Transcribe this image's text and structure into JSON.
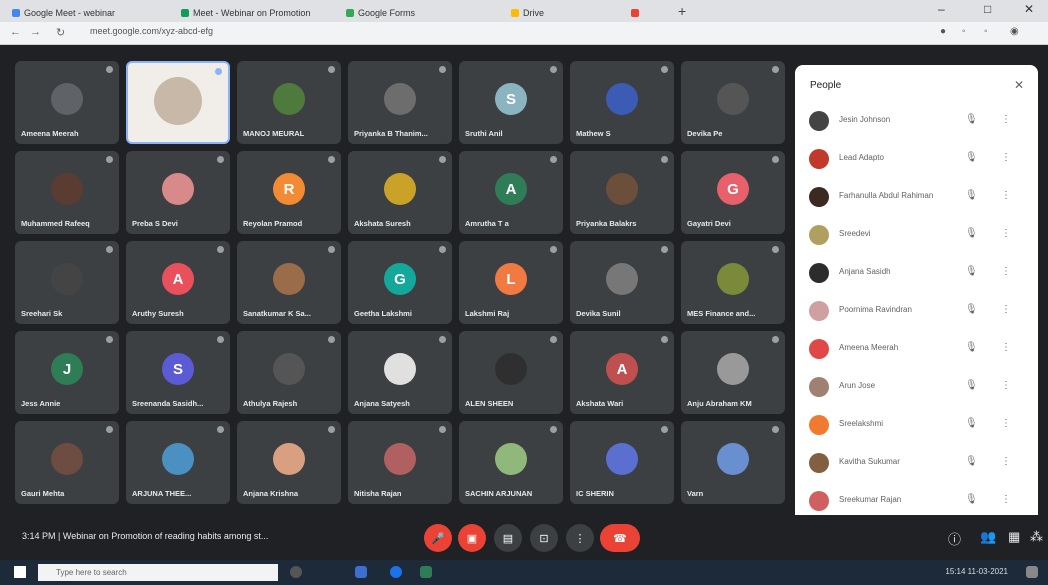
{
  "browser": {
    "tabs": [
      {
        "label": "Google Meet - webinar",
        "color": "#4285f4"
      },
      {
        "label": "Meet - Webinar on Promotion",
        "color": "#0f9d58"
      },
      {
        "label": "Google Forms",
        "color": "#34a853"
      },
      {
        "label": "Drive",
        "color": "#fbbc04"
      },
      {
        "label": "",
        "color": "#ea4335"
      }
    ],
    "new_tab": "+",
    "url": "meet.google.com/xyz-abcd-efg",
    "window_controls": {
      "minimize": "–",
      "maximize": "□",
      "close": "✕"
    }
  },
  "participants": [
    {
      "name": "Ameena Meerah",
      "color": "#5f6368",
      "initial": ""
    },
    {
      "name": "",
      "color": "#e8e2d8",
      "initial": ""
    },
    {
      "name": "MANOJ MEURAL",
      "color": "#4e7a3e",
      "initial": ""
    },
    {
      "name": "Priyanka B Thanim...",
      "color": "#6d6d6d",
      "initial": ""
    },
    {
      "name": "Sruthi Anil",
      "color": "#8ab4c0",
      "initial": "S"
    },
    {
      "name": "Mathew S",
      "color": "#3b5bb5",
      "initial": ""
    },
    {
      "name": "Devika Pe",
      "color": "#555",
      "initial": ""
    },
    {
      "name": "Muhammed Rafeeq",
      "color": "#5a3c32",
      "initial": ""
    },
    {
      "name": "Preba S Devi",
      "color": "#d88a8a",
      "initial": ""
    },
    {
      "name": "Reyolan Pramod",
      "color": "#f28b31",
      "initial": "R"
    },
    {
      "name": "Akshata Suresh",
      "color": "#c9a227",
      "initial": ""
    },
    {
      "name": "Amrutha T a",
      "color": "#2e7d57",
      "initial": "A"
    },
    {
      "name": "Priyanka Balakrs",
      "color": "#6b4f3a",
      "initial": ""
    },
    {
      "name": "Gayatri Devi",
      "color": "#e8606a",
      "initial": "G"
    },
    {
      "name": "Sreehari Sk",
      "color": "#444",
      "initial": ""
    },
    {
      "name": "Aruthy Suresh",
      "color": "#e8505b",
      "initial": "A"
    },
    {
      "name": "Sanatkumar K Sa...",
      "color": "#9a6c4a",
      "initial": ""
    },
    {
      "name": "Geetha Lakshmi",
      "color": "#14a89b",
      "initial": "G"
    },
    {
      "name": "Lakshmi Raj",
      "color": "#f07a42",
      "initial": "L"
    },
    {
      "name": "Devika Sunil",
      "color": "#777",
      "initial": ""
    },
    {
      "name": "MES Finance and...",
      "color": "#7a8a3a",
      "initial": ""
    },
    {
      "name": "Jess Annie",
      "color": "#2e7d57",
      "initial": "J"
    },
    {
      "name": "Sreenanda Sasidh...",
      "color": "#5b5bd6",
      "initial": "S"
    },
    {
      "name": "Athulya Rajesh",
      "color": "#555",
      "initial": ""
    },
    {
      "name": "Anjana Satyesh",
      "color": "#e0e0e0",
      "initial": ""
    },
    {
      "name": "ALEN SHEEN",
      "color": "#2f2f2f",
      "initial": ""
    },
    {
      "name": "Akshata Wari",
      "color": "#c05050",
      "initial": "A"
    },
    {
      "name": "Anju Abraham KM",
      "color": "#999",
      "initial": ""
    },
    {
      "name": "Gauri Mehta",
      "color": "#6d4c41",
      "initial": ""
    },
    {
      "name": "ARJUNA THEE...",
      "color": "#4a90c0",
      "initial": ""
    },
    {
      "name": "Anjana Krishna",
      "color": "#d8a080",
      "initial": ""
    },
    {
      "name": "Nitisha Rajan",
      "color": "#b06060",
      "initial": ""
    },
    {
      "name": "SACHIN ARJUNAN",
      "color": "#8fb87a",
      "initial": ""
    },
    {
      "name": "IC SHERIN",
      "color": "#5a6fd0",
      "initial": ""
    },
    {
      "name": "Varn",
      "color": "#6a8fd0",
      "initial": ""
    }
  ],
  "people_panel": {
    "title": "People",
    "close": "✕",
    "list": [
      {
        "name": "Jesin Johnson",
        "color": "#444"
      },
      {
        "name": "Lead Adapto",
        "color": "#c0392b"
      },
      {
        "name": "Farhanulla Abdul Rahiman",
        "color": "#3b2a20"
      },
      {
        "name": "Sreedevi",
        "color": "#b0a060"
      },
      {
        "name": "Anjana Sasidh",
        "color": "#2c2c2c"
      },
      {
        "name": "Poornima Ravindran",
        "color": "#d0a0a0"
      },
      {
        "name": "Ameena Meerah",
        "color": "#e04848"
      },
      {
        "name": "Arun Jose",
        "color": "#a08070"
      },
      {
        "name": "Sreelakshmi",
        "color": "#f07a30"
      },
      {
        "name": "Kavitha Sukumar",
        "color": "#806040"
      },
      {
        "name": "Sreekumar Rajan",
        "color": "#d06060"
      }
    ]
  },
  "bottom": {
    "time": "3:14 PM",
    "separator": "|",
    "meeting_title": "Webinar on Promotion of reading habits among st..."
  },
  "taskbar": {
    "search_placeholder": "Type here to search",
    "time": "15:14",
    "date": "11-03-2021"
  }
}
